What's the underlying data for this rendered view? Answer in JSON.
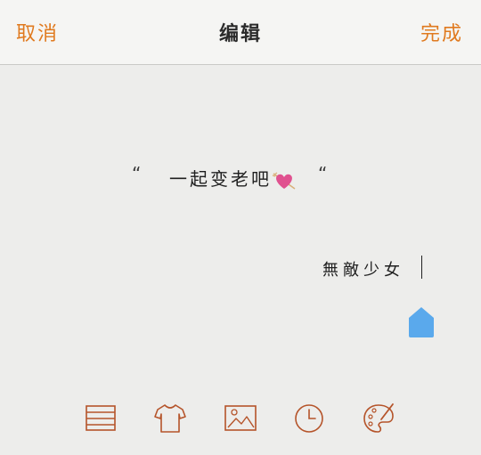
{
  "header": {
    "cancel_label": "取消",
    "title": "编辑",
    "done_label": "完成"
  },
  "content": {
    "quote_open": "“",
    "text": "一起变老吧",
    "quote_close": "“",
    "signature": "無敵少女"
  },
  "toolbar": {
    "items": [
      {
        "name": "lines-icon"
      },
      {
        "name": "shirt-icon"
      },
      {
        "name": "image-icon"
      },
      {
        "name": "clock-icon"
      },
      {
        "name": "palette-icon"
      }
    ]
  },
  "colors": {
    "accent": "#e07a1f",
    "background": "#ededeb",
    "header_bg": "#f5f5f3",
    "handle": "#5aa9ec",
    "icon": "#b5542a",
    "heart": "#e0518f"
  }
}
